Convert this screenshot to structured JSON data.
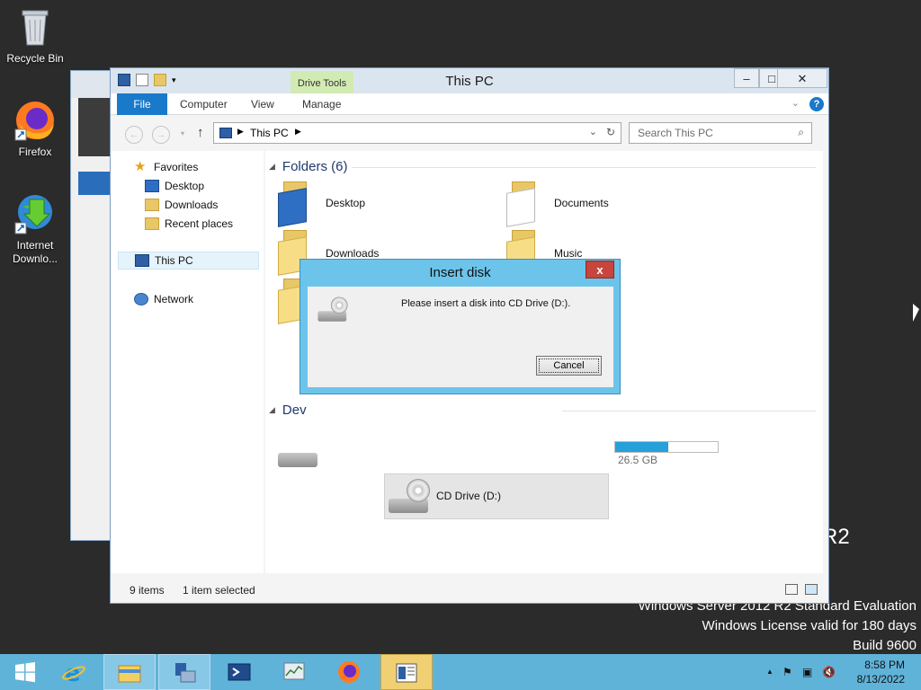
{
  "desktop": {
    "icons": [
      {
        "label": "Recycle Bin"
      },
      {
        "label": "Firefox"
      },
      {
        "label": "Internet Downlo..."
      }
    ],
    "watermark": {
      "line1": "Windows Server 2012 R2 Standard Evaluation",
      "line2": "Windows License valid for 180 days",
      "line3": "Build 9600",
      "r2": "R2"
    }
  },
  "explorer": {
    "title": "This PC",
    "context_tab": "Drive Tools",
    "ribbon_tabs": [
      "File",
      "Computer",
      "View",
      "Manage"
    ],
    "address": {
      "crumb": "This PC"
    },
    "search_placeholder": "Search This PC",
    "nav": {
      "favorites": "Favorites",
      "desktop": "Desktop",
      "downloads": "Downloads",
      "recent": "Recent places",
      "this_pc": "This PC",
      "network": "Network"
    },
    "folders_header": "Folders (6)",
    "devices_header_visible": "Dev",
    "folders": [
      {
        "name": "Desktop"
      },
      {
        "name": "Documents"
      },
      {
        "name": "Downloads"
      },
      {
        "name": "Music"
      }
    ],
    "drive_free_text_visible": "26.5 GB",
    "drive_usage_fraction": 0.52,
    "cd_drive": "CD Drive (D:)",
    "status": {
      "items": "9 items",
      "selected": "1 item selected"
    }
  },
  "dialog": {
    "title": "Insert disk",
    "message": "Please insert a disk into CD Drive (D:).",
    "cancel": "Cancel",
    "close": "x"
  },
  "taskbar": {
    "time": "8:58 PM",
    "date": "8/13/2022"
  },
  "colors": {
    "accent": "#1979ca",
    "taskbar": "#5fb3d9",
    "dialog_frame": "#6cc4eb",
    "close_red": "#c7453c"
  }
}
